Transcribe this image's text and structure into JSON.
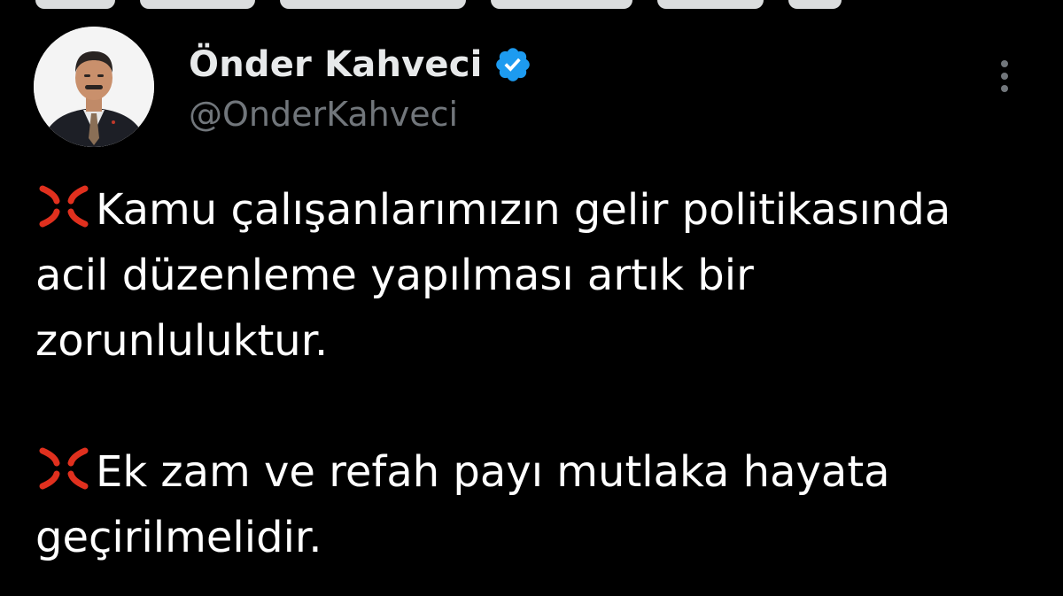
{
  "author": {
    "display_name": "Önder Kahveci",
    "handle": "@OnderKahveci",
    "verified_icon": "verified-badge-icon",
    "avatar_icon": "profile-avatar"
  },
  "tweet": {
    "paragraphs": [
      {
        "emoji": "anger-symbol-icon",
        "text": "Kamu çalışanlarımızın gelir politikasında acil düzenleme yapılması artık bir zorunluluktur."
      },
      {
        "emoji": "anger-symbol-icon",
        "text": "Ek zam ve refah payı mutlaka hayata geçirilmelidir."
      }
    ]
  },
  "menu": {
    "icon": "more-options-icon"
  },
  "colors": {
    "background": "#000000",
    "text_primary": "#e7e9ea",
    "text_secondary": "#71767b",
    "verified": "#1d9bf0",
    "anger_emoji": "#e0301e"
  }
}
